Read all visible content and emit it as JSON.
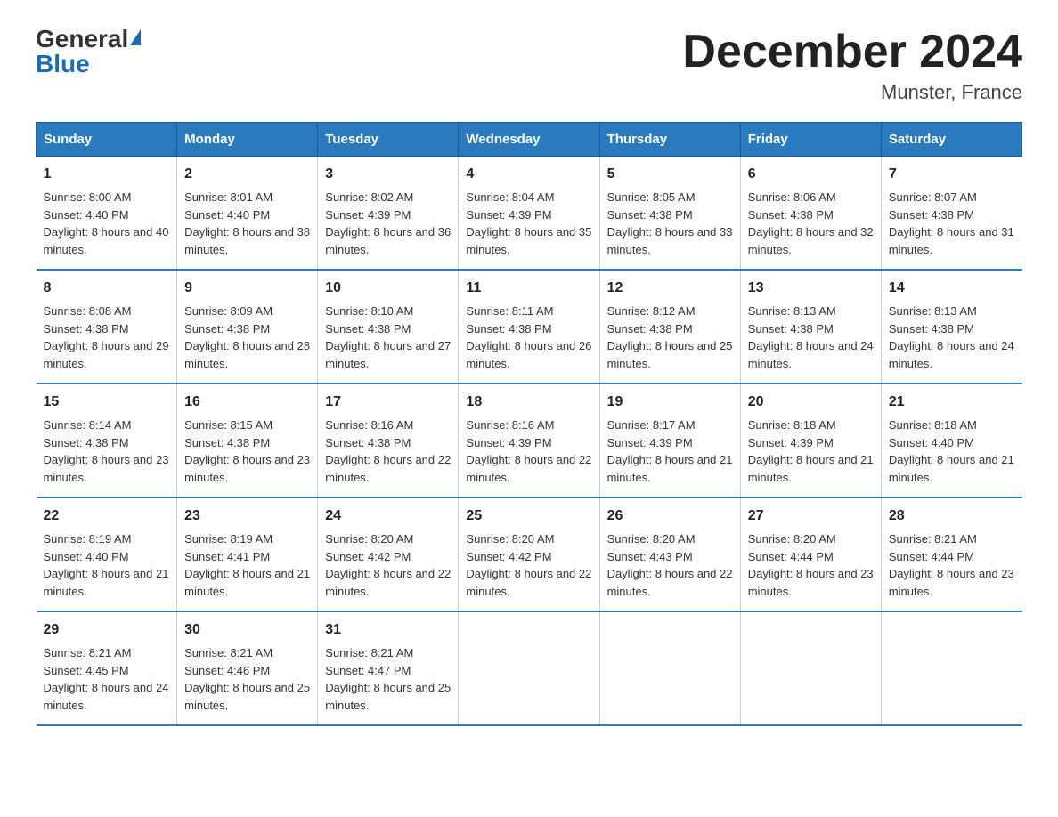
{
  "header": {
    "logo_general": "General",
    "logo_blue": "Blue",
    "title": "December 2024",
    "subtitle": "Munster, France"
  },
  "days_of_week": [
    "Sunday",
    "Monday",
    "Tuesday",
    "Wednesday",
    "Thursday",
    "Friday",
    "Saturday"
  ],
  "weeks": [
    [
      {
        "day": "1",
        "sunrise": "8:00 AM",
        "sunset": "4:40 PM",
        "daylight": "8 hours and 40 minutes."
      },
      {
        "day": "2",
        "sunrise": "8:01 AM",
        "sunset": "4:40 PM",
        "daylight": "8 hours and 38 minutes."
      },
      {
        "day": "3",
        "sunrise": "8:02 AM",
        "sunset": "4:39 PM",
        "daylight": "8 hours and 36 minutes."
      },
      {
        "day": "4",
        "sunrise": "8:04 AM",
        "sunset": "4:39 PM",
        "daylight": "8 hours and 35 minutes."
      },
      {
        "day": "5",
        "sunrise": "8:05 AM",
        "sunset": "4:38 PM",
        "daylight": "8 hours and 33 minutes."
      },
      {
        "day": "6",
        "sunrise": "8:06 AM",
        "sunset": "4:38 PM",
        "daylight": "8 hours and 32 minutes."
      },
      {
        "day": "7",
        "sunrise": "8:07 AM",
        "sunset": "4:38 PM",
        "daylight": "8 hours and 31 minutes."
      }
    ],
    [
      {
        "day": "8",
        "sunrise": "8:08 AM",
        "sunset": "4:38 PM",
        "daylight": "8 hours and 29 minutes."
      },
      {
        "day": "9",
        "sunrise": "8:09 AM",
        "sunset": "4:38 PM",
        "daylight": "8 hours and 28 minutes."
      },
      {
        "day": "10",
        "sunrise": "8:10 AM",
        "sunset": "4:38 PM",
        "daylight": "8 hours and 27 minutes."
      },
      {
        "day": "11",
        "sunrise": "8:11 AM",
        "sunset": "4:38 PM",
        "daylight": "8 hours and 26 minutes."
      },
      {
        "day": "12",
        "sunrise": "8:12 AM",
        "sunset": "4:38 PM",
        "daylight": "8 hours and 25 minutes."
      },
      {
        "day": "13",
        "sunrise": "8:13 AM",
        "sunset": "4:38 PM",
        "daylight": "8 hours and 24 minutes."
      },
      {
        "day": "14",
        "sunrise": "8:13 AM",
        "sunset": "4:38 PM",
        "daylight": "8 hours and 24 minutes."
      }
    ],
    [
      {
        "day": "15",
        "sunrise": "8:14 AM",
        "sunset": "4:38 PM",
        "daylight": "8 hours and 23 minutes."
      },
      {
        "day": "16",
        "sunrise": "8:15 AM",
        "sunset": "4:38 PM",
        "daylight": "8 hours and 23 minutes."
      },
      {
        "day": "17",
        "sunrise": "8:16 AM",
        "sunset": "4:38 PM",
        "daylight": "8 hours and 22 minutes."
      },
      {
        "day": "18",
        "sunrise": "8:16 AM",
        "sunset": "4:39 PM",
        "daylight": "8 hours and 22 minutes."
      },
      {
        "day": "19",
        "sunrise": "8:17 AM",
        "sunset": "4:39 PM",
        "daylight": "8 hours and 21 minutes."
      },
      {
        "day": "20",
        "sunrise": "8:18 AM",
        "sunset": "4:39 PM",
        "daylight": "8 hours and 21 minutes."
      },
      {
        "day": "21",
        "sunrise": "8:18 AM",
        "sunset": "4:40 PM",
        "daylight": "8 hours and 21 minutes."
      }
    ],
    [
      {
        "day": "22",
        "sunrise": "8:19 AM",
        "sunset": "4:40 PM",
        "daylight": "8 hours and 21 minutes."
      },
      {
        "day": "23",
        "sunrise": "8:19 AM",
        "sunset": "4:41 PM",
        "daylight": "8 hours and 21 minutes."
      },
      {
        "day": "24",
        "sunrise": "8:20 AM",
        "sunset": "4:42 PM",
        "daylight": "8 hours and 22 minutes."
      },
      {
        "day": "25",
        "sunrise": "8:20 AM",
        "sunset": "4:42 PM",
        "daylight": "8 hours and 22 minutes."
      },
      {
        "day": "26",
        "sunrise": "8:20 AM",
        "sunset": "4:43 PM",
        "daylight": "8 hours and 22 minutes."
      },
      {
        "day": "27",
        "sunrise": "8:20 AM",
        "sunset": "4:44 PM",
        "daylight": "8 hours and 23 minutes."
      },
      {
        "day": "28",
        "sunrise": "8:21 AM",
        "sunset": "4:44 PM",
        "daylight": "8 hours and 23 minutes."
      }
    ],
    [
      {
        "day": "29",
        "sunrise": "8:21 AM",
        "sunset": "4:45 PM",
        "daylight": "8 hours and 24 minutes."
      },
      {
        "day": "30",
        "sunrise": "8:21 AM",
        "sunset": "4:46 PM",
        "daylight": "8 hours and 25 minutes."
      },
      {
        "day": "31",
        "sunrise": "8:21 AM",
        "sunset": "4:47 PM",
        "daylight": "8 hours and 25 minutes."
      },
      null,
      null,
      null,
      null
    ]
  ]
}
